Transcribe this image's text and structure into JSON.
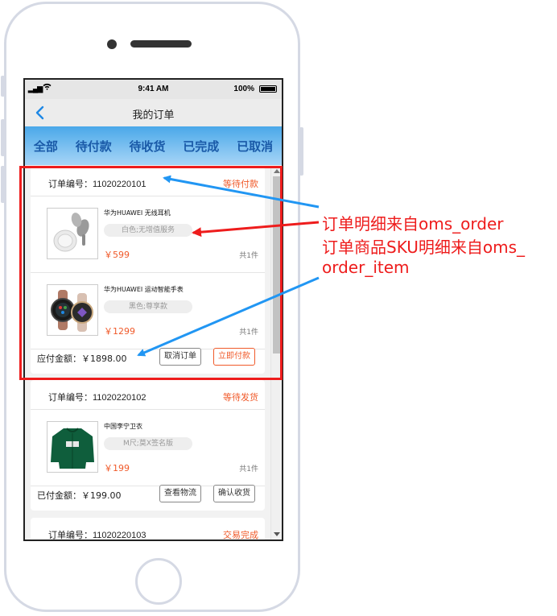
{
  "status_bar": {
    "time": "9:41 AM",
    "battery": "100%"
  },
  "nav": {
    "back_icon": "chevron-left-icon",
    "title": "我的订单"
  },
  "tabs": [
    "全部",
    "待付款",
    "待收货",
    "已完成",
    "已取消"
  ],
  "orders": [
    {
      "order_no_label": "订单编号：",
      "order_no": "11020220101",
      "status": "等待付款",
      "items": [
        {
          "name": "华为HUAWEI 无线耳机",
          "spec": "白色;无增值服务",
          "price": "￥599",
          "qty": "共1件"
        },
        {
          "name": "华为HUAWEI 运动智能手表",
          "spec": "黑色;尊享款",
          "price": "￥1299",
          "qty": "共1件"
        }
      ],
      "total_label": "应付金额：",
      "total": "￥1898.00",
      "buttons": [
        "取消订单",
        "立即付款"
      ]
    },
    {
      "order_no_label": "订单编号：",
      "order_no": "11020220102",
      "status": "等待发货",
      "items": [
        {
          "name": "中国李宁卫衣",
          "spec": "M尺;莫X签名版",
          "price": "￥199",
          "qty": "共1件"
        }
      ],
      "total_label": "已付金额：",
      "total": "￥199.00",
      "buttons": [
        "查看物流",
        "确认收货"
      ]
    },
    {
      "order_no_label": "订单编号：",
      "order_no": "11020220103",
      "status": "交易完成"
    }
  ],
  "annotations": [
    "订单明细来自oms_order",
    "订单商品SKU明细来自oms_",
    "order_item"
  ],
  "colors": {
    "accent": "#1e88e5",
    "price": "#f05a2a",
    "highlight": "#ee1c1c",
    "tab_text": "#1a5aa8"
  }
}
